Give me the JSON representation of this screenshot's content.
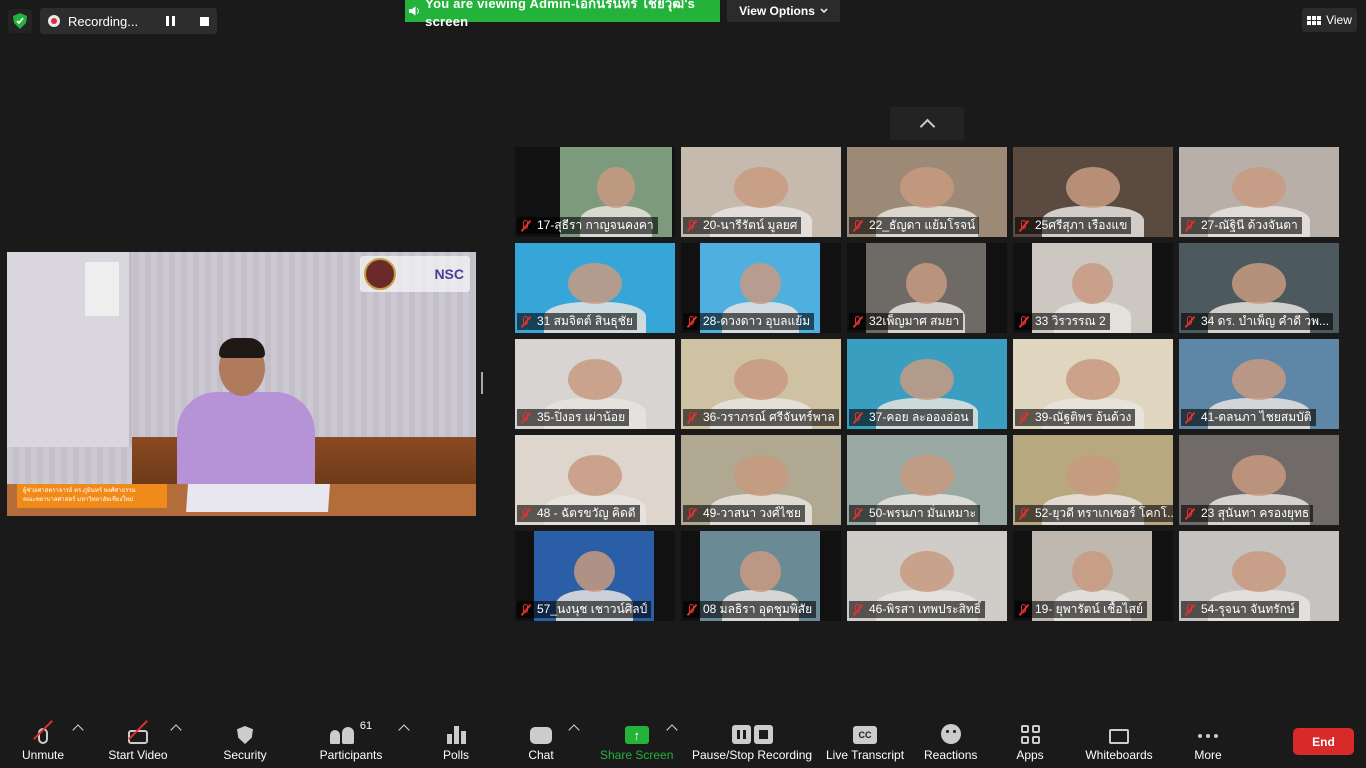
{
  "recording": {
    "label": "Recording..."
  },
  "share_banner": {
    "text": "You are viewing Admin-เอกนรินทร์ ไชยวุฒิ's screen",
    "view_options": "View Options"
  },
  "view_button": {
    "label": "View"
  },
  "speaker": {
    "logo_text": "NSC",
    "banner_lines": [
      "ผู้ช่วยศาสตราจารย์ ดร.ภูมินทร์ พงศ์ศาธรรม",
      "คณะพยาบาลศาสตร์ มหาวิทยาลัยเชียงใหม่"
    ]
  },
  "participants_grid": [
    {
      "label": "17-สุธีรา กาญจนคงคา",
      "bg": "#7e9a7c"
    },
    {
      "label": "20-นารีรัตน์ มูลยศ",
      "bg": "#c6b9ae"
    },
    {
      "label": "22_ธัญดา แย้มโรจน์",
      "bg": "#9c8a76"
    },
    {
      "label": "25ศรีสุภา เรืองแข",
      "bg": "#5a4a40"
    },
    {
      "label": "27-ณัฐินี ด้วงจันตา",
      "bg": "#b8b0a8"
    },
    {
      "label": "31 สมจิตต์ สินธุชัย",
      "bg": "#36a6d8"
    },
    {
      "label": "28-ดวงดาว อุบลแย้ม",
      "bg": "#4fb0e0"
    },
    {
      "label": "32เพ็ญมาศ สมยา",
      "bg": "#6e6a66"
    },
    {
      "label": "33 วิรวรรณ 2",
      "bg": "#ccc7c0"
    },
    {
      "label": "34 ดร. บำเพ็ญ  คำดี  วพ...",
      "bg": "#4c5a60"
    },
    {
      "label": "35-ปิ่งอร เผ่าน้อย",
      "bg": "#d7d4d2"
    },
    {
      "label": "36-วราภรณ์  ศรีจันทร์พาล",
      "bg": "#cfc2a2"
    },
    {
      "label": "37-คอย ละอองอ่อน",
      "bg": "#3a9ec0"
    },
    {
      "label": "39-ณัฐติพร  อ้นด้วง",
      "bg": "#e0d6c0"
    },
    {
      "label": "41-ดลนภา ไชยสมบัติ",
      "bg": "#5e86a6"
    },
    {
      "label": "48 - ฉัตรขวัญ คิดดี",
      "bg": "#ded6cc"
    },
    {
      "label": "49-วาสนา วงศ์ไชย",
      "bg": "#b0a890"
    },
    {
      "label": "50-พรนภา มั่นเหมาะ",
      "bg": "#9aa8a4"
    },
    {
      "label": "52-ยุวดี ทราเกเซอร์ โคกโ...",
      "bg": "#b8a880"
    },
    {
      "label": "23 สุนันทา ครองยุทธ",
      "bg": "#706a68"
    },
    {
      "label": "57_นงนุช เชาวน์ศิลป์",
      "bg": "#2a5ea6"
    },
    {
      "label": "08 มลธิรา อุดชุมพิสัย",
      "bg": "#6a8a96"
    },
    {
      "label": "46-พิรสา เทพประสิทธิ์",
      "bg": "#d0ccc8"
    },
    {
      "label": "19- ยุพารัตน์ เชื้อไสย์",
      "bg": "#bfb8ae"
    },
    {
      "label": "54-รุจนา จันทรักษ์",
      "bg": "#c6c2c0"
    }
  ],
  "toolbar": {
    "unmute": "Unmute",
    "start_video": "Start Video",
    "security": "Security",
    "participants": "Participants",
    "participants_count": "61",
    "polls": "Polls",
    "chat": "Chat",
    "share_screen": "Share Screen",
    "pause_stop_recording": "Pause/Stop Recording",
    "live_transcript": "Live Transcript",
    "cc_text": "CC",
    "reactions": "Reactions",
    "apps": "Apps",
    "whiteboards": "Whiteboards",
    "more": "More",
    "end": "End"
  },
  "colors": {
    "share_green": "#23b33a",
    "end_red": "#d92a2a",
    "muted_red": "#e0312f"
  }
}
